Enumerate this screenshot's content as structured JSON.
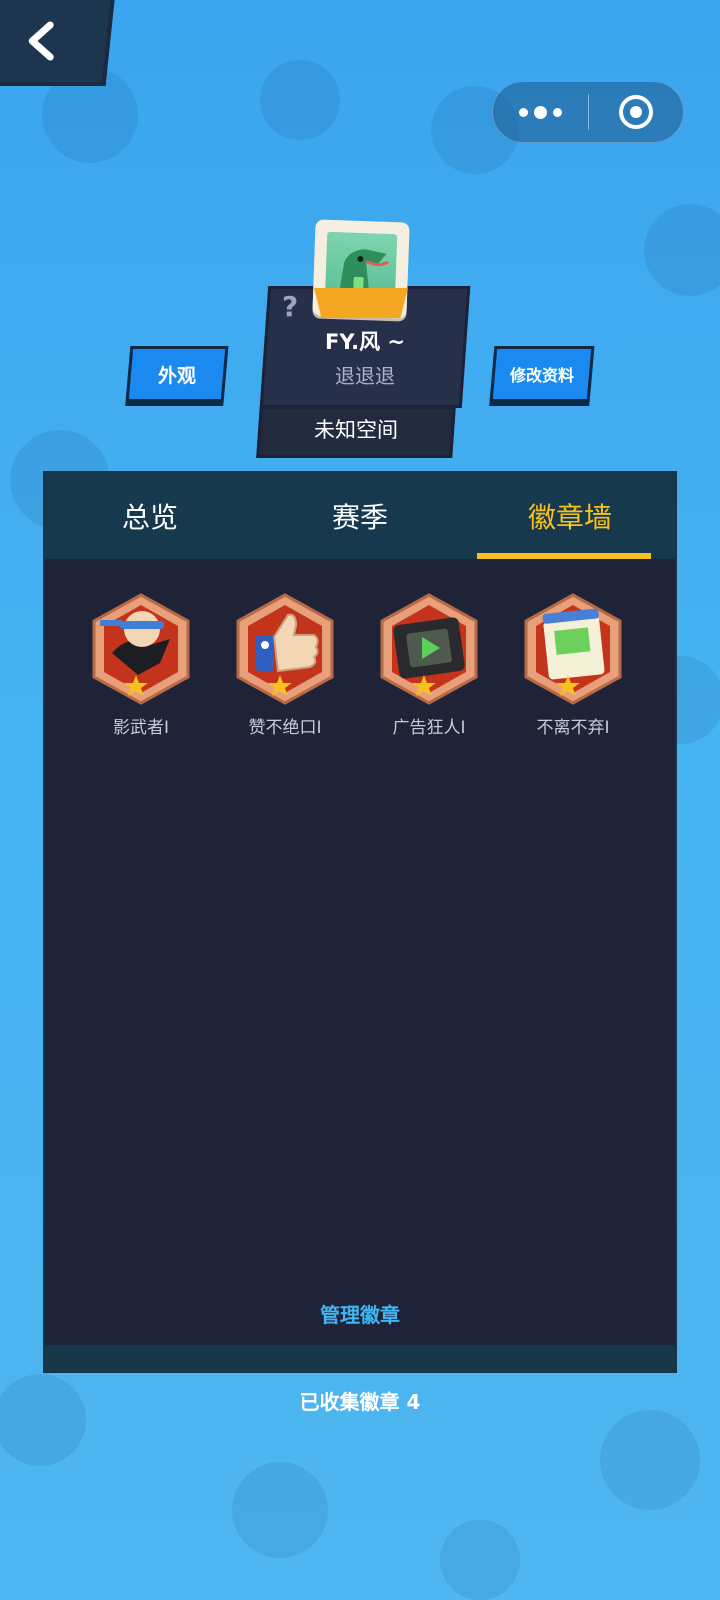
{
  "header": {
    "back_icon": "chevron-left-icon",
    "capsule": {
      "more_icon": "more-dots-icon",
      "close_icon": "target-circle-icon"
    }
  },
  "profile": {
    "question_mark": "?",
    "username": "FY.风 ~",
    "signature": "退退退",
    "space": "未知空间",
    "appearance_button": "外观",
    "edit_button": "修改资料"
  },
  "tabs": [
    {
      "label": "总览",
      "active": false
    },
    {
      "label": "赛季",
      "active": false
    },
    {
      "label": "徽章墙",
      "active": true
    }
  ],
  "badges": [
    {
      "label": "影武者Ⅰ",
      "icon": "ninja-icon"
    },
    {
      "label": "赞不绝口Ⅰ",
      "icon": "thumbs-up-icon"
    },
    {
      "label": "广告狂人Ⅰ",
      "icon": "film-play-icon"
    },
    {
      "label": "不离不弃Ⅰ",
      "icon": "calendar-icon"
    }
  ],
  "manage_link": "管理徽章",
  "collected_text": "已收集徽章 4",
  "colors": {
    "accent": "#f7c21d",
    "link": "#3fb6f0",
    "panel_bg": "#1f2338",
    "tab_bg": "#17394d",
    "button_blue": "#1a8af0"
  }
}
